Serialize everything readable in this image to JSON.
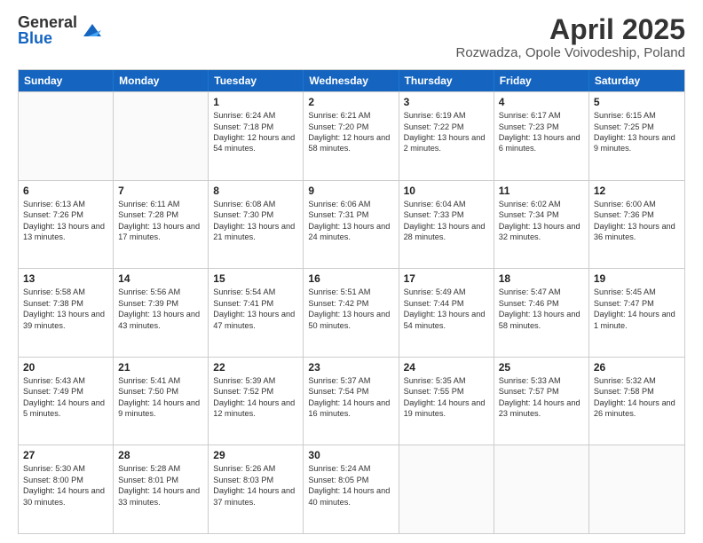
{
  "logo": {
    "general": "General",
    "blue": "Blue"
  },
  "header": {
    "title": "April 2025",
    "subtitle": "Rozwadza, Opole Voivodeship, Poland"
  },
  "days": [
    "Sunday",
    "Monday",
    "Tuesday",
    "Wednesday",
    "Thursday",
    "Friday",
    "Saturday"
  ],
  "weeks": [
    [
      {
        "day": "",
        "content": ""
      },
      {
        "day": "",
        "content": ""
      },
      {
        "day": "1",
        "content": "Sunrise: 6:24 AM\nSunset: 7:18 PM\nDaylight: 12 hours and 54 minutes."
      },
      {
        "day": "2",
        "content": "Sunrise: 6:21 AM\nSunset: 7:20 PM\nDaylight: 12 hours and 58 minutes."
      },
      {
        "day": "3",
        "content": "Sunrise: 6:19 AM\nSunset: 7:22 PM\nDaylight: 13 hours and 2 minutes."
      },
      {
        "day": "4",
        "content": "Sunrise: 6:17 AM\nSunset: 7:23 PM\nDaylight: 13 hours and 6 minutes."
      },
      {
        "day": "5",
        "content": "Sunrise: 6:15 AM\nSunset: 7:25 PM\nDaylight: 13 hours and 9 minutes."
      }
    ],
    [
      {
        "day": "6",
        "content": "Sunrise: 6:13 AM\nSunset: 7:26 PM\nDaylight: 13 hours and 13 minutes."
      },
      {
        "day": "7",
        "content": "Sunrise: 6:11 AM\nSunset: 7:28 PM\nDaylight: 13 hours and 17 minutes."
      },
      {
        "day": "8",
        "content": "Sunrise: 6:08 AM\nSunset: 7:30 PM\nDaylight: 13 hours and 21 minutes."
      },
      {
        "day": "9",
        "content": "Sunrise: 6:06 AM\nSunset: 7:31 PM\nDaylight: 13 hours and 24 minutes."
      },
      {
        "day": "10",
        "content": "Sunrise: 6:04 AM\nSunset: 7:33 PM\nDaylight: 13 hours and 28 minutes."
      },
      {
        "day": "11",
        "content": "Sunrise: 6:02 AM\nSunset: 7:34 PM\nDaylight: 13 hours and 32 minutes."
      },
      {
        "day": "12",
        "content": "Sunrise: 6:00 AM\nSunset: 7:36 PM\nDaylight: 13 hours and 36 minutes."
      }
    ],
    [
      {
        "day": "13",
        "content": "Sunrise: 5:58 AM\nSunset: 7:38 PM\nDaylight: 13 hours and 39 minutes."
      },
      {
        "day": "14",
        "content": "Sunrise: 5:56 AM\nSunset: 7:39 PM\nDaylight: 13 hours and 43 minutes."
      },
      {
        "day": "15",
        "content": "Sunrise: 5:54 AM\nSunset: 7:41 PM\nDaylight: 13 hours and 47 minutes."
      },
      {
        "day": "16",
        "content": "Sunrise: 5:51 AM\nSunset: 7:42 PM\nDaylight: 13 hours and 50 minutes."
      },
      {
        "day": "17",
        "content": "Sunrise: 5:49 AM\nSunset: 7:44 PM\nDaylight: 13 hours and 54 minutes."
      },
      {
        "day": "18",
        "content": "Sunrise: 5:47 AM\nSunset: 7:46 PM\nDaylight: 13 hours and 58 minutes."
      },
      {
        "day": "19",
        "content": "Sunrise: 5:45 AM\nSunset: 7:47 PM\nDaylight: 14 hours and 1 minute."
      }
    ],
    [
      {
        "day": "20",
        "content": "Sunrise: 5:43 AM\nSunset: 7:49 PM\nDaylight: 14 hours and 5 minutes."
      },
      {
        "day": "21",
        "content": "Sunrise: 5:41 AM\nSunset: 7:50 PM\nDaylight: 14 hours and 9 minutes."
      },
      {
        "day": "22",
        "content": "Sunrise: 5:39 AM\nSunset: 7:52 PM\nDaylight: 14 hours and 12 minutes."
      },
      {
        "day": "23",
        "content": "Sunrise: 5:37 AM\nSunset: 7:54 PM\nDaylight: 14 hours and 16 minutes."
      },
      {
        "day": "24",
        "content": "Sunrise: 5:35 AM\nSunset: 7:55 PM\nDaylight: 14 hours and 19 minutes."
      },
      {
        "day": "25",
        "content": "Sunrise: 5:33 AM\nSunset: 7:57 PM\nDaylight: 14 hours and 23 minutes."
      },
      {
        "day": "26",
        "content": "Sunrise: 5:32 AM\nSunset: 7:58 PM\nDaylight: 14 hours and 26 minutes."
      }
    ],
    [
      {
        "day": "27",
        "content": "Sunrise: 5:30 AM\nSunset: 8:00 PM\nDaylight: 14 hours and 30 minutes."
      },
      {
        "day": "28",
        "content": "Sunrise: 5:28 AM\nSunset: 8:01 PM\nDaylight: 14 hours and 33 minutes."
      },
      {
        "day": "29",
        "content": "Sunrise: 5:26 AM\nSunset: 8:03 PM\nDaylight: 14 hours and 37 minutes."
      },
      {
        "day": "30",
        "content": "Sunrise: 5:24 AM\nSunset: 8:05 PM\nDaylight: 14 hours and 40 minutes."
      },
      {
        "day": "",
        "content": ""
      },
      {
        "day": "",
        "content": ""
      },
      {
        "day": "",
        "content": ""
      }
    ]
  ]
}
